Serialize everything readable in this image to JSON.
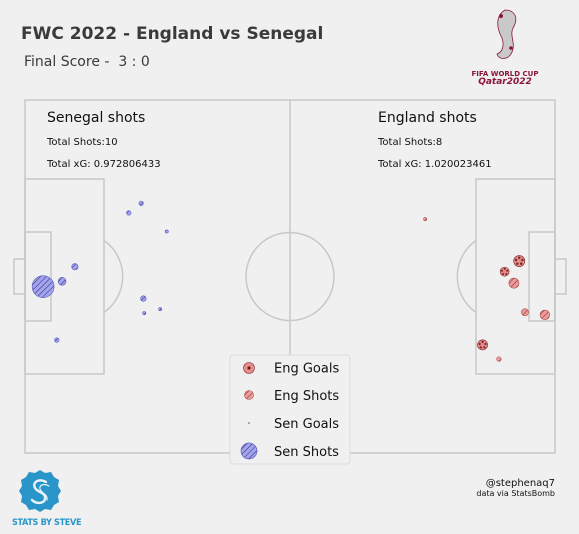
{
  "header": {
    "title": "FWC 2022 - England vs Senegal",
    "subtitle": "Final Score -  3 : 0"
  },
  "teams": {
    "left": {
      "name": "Senegal shots",
      "total_shots": "Total Shots:10",
      "total_xg": "Total xG: 0.972806433"
    },
    "right": {
      "name": "England shots",
      "total_shots": "Total Shots:8",
      "total_xg": "Total xG: 1.020023461"
    }
  },
  "legend": {
    "items": [
      {
        "label": "Eng Goals",
        "marker": "football",
        "color": "#e58e8e"
      },
      {
        "label": "Eng Shots",
        "marker": "hatched",
        "color": "#e58e8e"
      },
      {
        "label": "Sen Goals",
        "marker": "dot",
        "color": "#6a6ad8"
      },
      {
        "label": "Sen Shots",
        "marker": "hatched",
        "color": "#8f8fe8"
      }
    ]
  },
  "chart_data": {
    "type": "scatter",
    "pitch": {
      "length": 120,
      "width": 80,
      "provider": "StatsBomb"
    },
    "series": [
      {
        "name": "Eng Goals",
        "color": "#e58e8e",
        "marker": "football",
        "points": [
          {
            "x": 111.9,
            "y": 36.5,
            "xg": 0.12
          },
          {
            "x": 108.6,
            "y": 38.9,
            "xg": 0.08
          },
          {
            "x": 103.6,
            "y": 55.5,
            "xg": 0.1
          }
        ]
      },
      {
        "name": "Eng Shots",
        "color": "#e58e8e",
        "marker": "hatched",
        "points": [
          {
            "x": 90.6,
            "y": 27.0,
            "xg": 0.01
          },
          {
            "x": 110.7,
            "y": 41.5,
            "xg": 0.1
          },
          {
            "x": 113.2,
            "y": 48.1,
            "xg": 0.05
          },
          {
            "x": 117.7,
            "y": 48.7,
            "xg": 0.09
          },
          {
            "x": 107.3,
            "y": 58.7,
            "xg": 0.02
          }
        ]
      },
      {
        "name": "Sen Goals",
        "color": "#6a6ad8",
        "points": []
      },
      {
        "name": "Sen Shots",
        "color": "#8f8fe8",
        "marker": "hatched",
        "points": [
          {
            "x": 4.1,
            "y": 42.3,
            "xg": 0.47
          },
          {
            "x": 8.4,
            "y": 41.1,
            "xg": 0.06
          },
          {
            "x": 11.3,
            "y": 37.8,
            "xg": 0.04
          },
          {
            "x": 7.2,
            "y": 54.4,
            "xg": 0.02
          },
          {
            "x": 23.5,
            "y": 25.6,
            "xg": 0.02
          },
          {
            "x": 26.3,
            "y": 23.4,
            "xg": 0.02
          },
          {
            "x": 32.1,
            "y": 29.8,
            "xg": 0.01
          },
          {
            "x": 26.8,
            "y": 45.0,
            "xg": 0.03
          },
          {
            "x": 27.0,
            "y": 48.3,
            "xg": 0.01
          },
          {
            "x": 30.6,
            "y": 47.4,
            "xg": 0.01
          }
        ]
      }
    ]
  },
  "footer": {
    "handle": "@stephenaq7",
    "source": "data via StatsBomb",
    "brand": "STATS BY STEVE",
    "event_logo_line1": "FIFA WORLD CUP",
    "event_logo_line2": "Qatar2022"
  }
}
